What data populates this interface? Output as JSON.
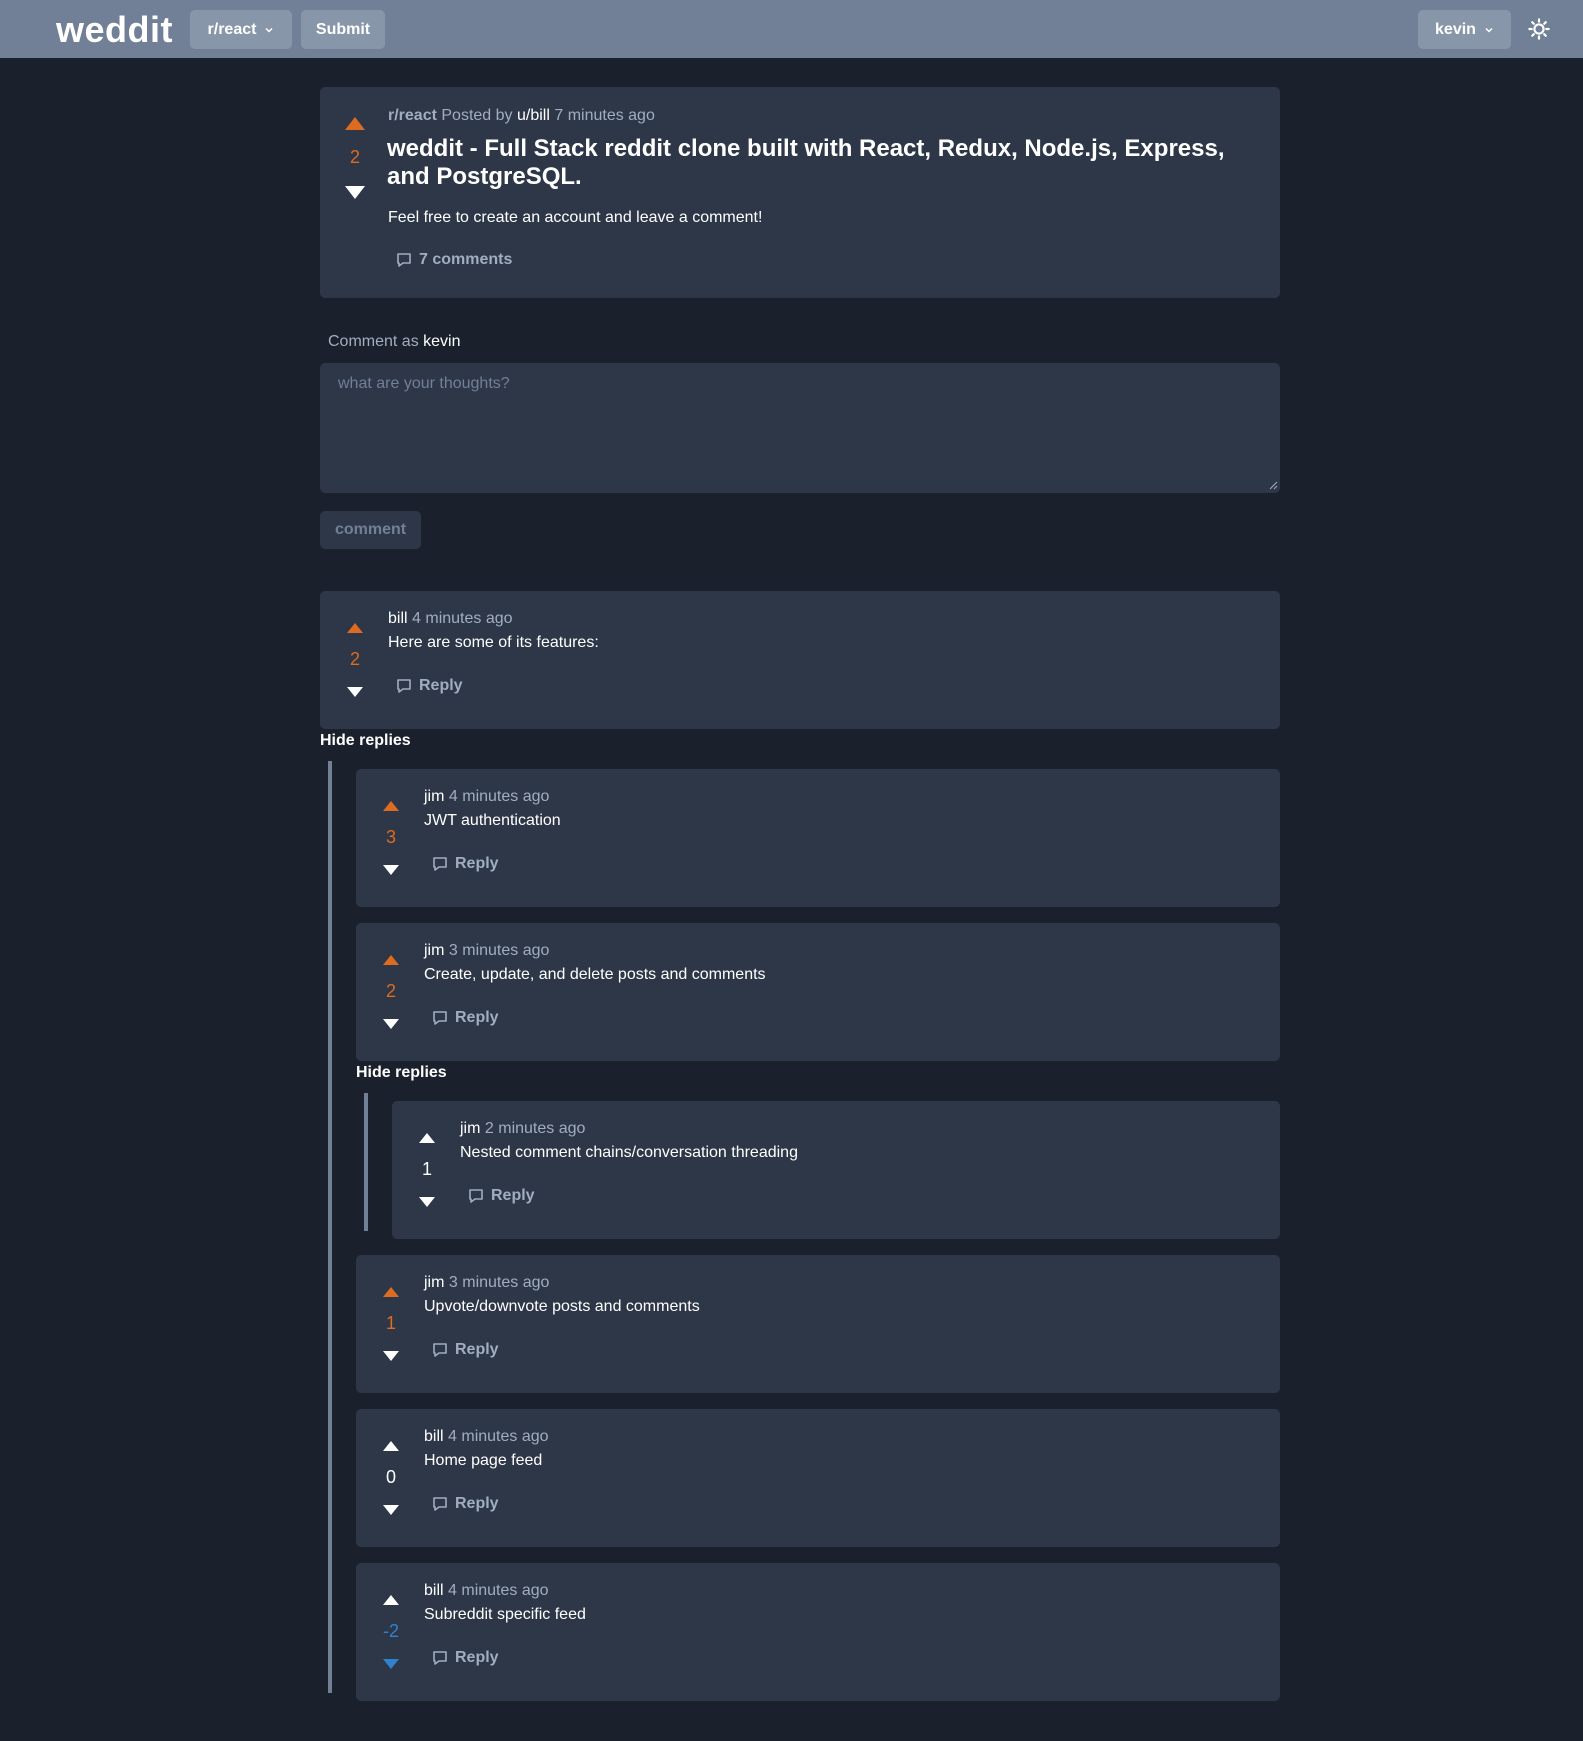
{
  "nav": {
    "logo": "weddit",
    "subreddit_select": "r/react",
    "submit": "Submit",
    "user_menu": "kevin"
  },
  "post": {
    "score": "2",
    "subreddit": "r/react",
    "posted_by": "Posted by",
    "author": "u/bill",
    "time": "7 minutes ago",
    "title": "weddit - Full Stack reddit clone built with React, Redux, Node.js, Express, and PostgreSQL.",
    "body": "Feel free to create an account and leave a comment!",
    "comments_link": "7 comments"
  },
  "comment_form": {
    "label": "Comment as",
    "user": "kevin",
    "placeholder": "what are your thoughts?",
    "button": "comment"
  },
  "hide_replies_label": "Hide replies",
  "reply_label": "Reply",
  "comments": [
    {
      "author": "bill",
      "time": "4 minutes ago",
      "body": "Here are some of its features:",
      "score": "2",
      "vote": "up"
    },
    {
      "author": "jim",
      "time": "4 minutes ago",
      "body": "JWT authentication",
      "score": "3",
      "vote": "up"
    },
    {
      "author": "jim",
      "time": "3 minutes ago",
      "body": "Create, update, and delete posts and comments",
      "score": "2",
      "vote": "up"
    },
    {
      "author": "jim",
      "time": "2 minutes ago",
      "body": "Nested comment chains/conversation threading",
      "score": "1",
      "vote": "none"
    },
    {
      "author": "jim",
      "time": "3 minutes ago",
      "body": "Upvote/downvote posts and comments",
      "score": "1",
      "vote": "up"
    },
    {
      "author": "bill",
      "time": "4 minutes ago",
      "body": "Home page feed",
      "score": "0",
      "vote": "none"
    },
    {
      "author": "bill",
      "time": "4 minutes ago",
      "body": "Subreddit specific feed",
      "score": "-2",
      "vote": "down"
    }
  ],
  "colors": {
    "background": "#1a202c",
    "card": "#2d3748",
    "navbar": "#718096",
    "upvote": "#dd6b20",
    "downvote": "#3182ce",
    "muted_text": "#a0aec0"
  }
}
